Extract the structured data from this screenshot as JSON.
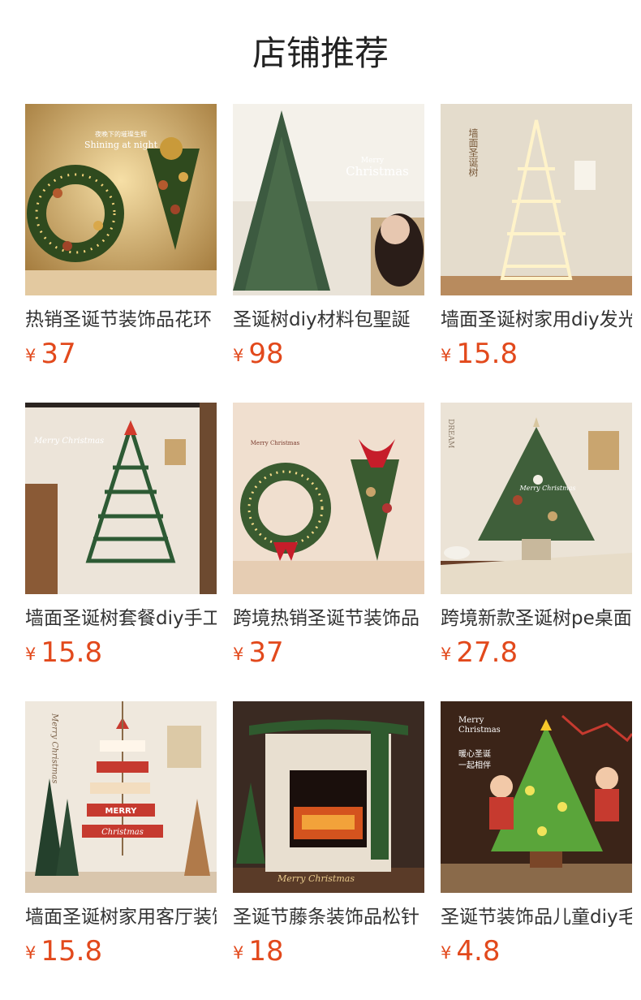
{
  "section": {
    "title": "店铺推荐"
  },
  "currency": "¥",
  "products": [
    {
      "name": "热销圣诞节装饰品花环",
      "price": "37",
      "image_text": [
        "夜晚下的璀璨生辉",
        "Shining at night"
      ],
      "icon": "christmas-wreath-icon"
    },
    {
      "name": "圣诞树diy材料包聖誕",
      "price": "98",
      "image_text": [
        "Merry",
        "Christmas"
      ],
      "icon": "christmas-tree-icon"
    },
    {
      "name": "墙面圣诞树家用diy发光",
      "price": "15.8",
      "image_text": [
        "墙面圣诞树"
      ],
      "icon": "wall-light-tree-icon"
    },
    {
      "name": "墙面圣诞树套餐diy手工",
      "price": "15.8",
      "image_text": [
        "Merry Christmas"
      ],
      "icon": "wall-garland-tree-icon"
    },
    {
      "name": "跨境热销圣诞节装饰品",
      "price": "37",
      "image_text": [
        "Merry Christmas"
      ],
      "icon": "wreath-pair-icon"
    },
    {
      "name": "跨境新款圣诞树pe桌面",
      "price": "27.8",
      "image_text": [
        "DREAM",
        "Merry Christmas"
      ],
      "icon": "tabletop-tree-icon"
    },
    {
      "name": "墙面圣诞树家用客厅装饰",
      "price": "15.8",
      "image_text": [
        "Merry Christmas",
        "MERRY",
        "Christmas"
      ],
      "icon": "wooden-sign-tree-icon"
    },
    {
      "name": "圣诞节藤条装饰品松针",
      "price": "18",
      "image_text": [
        "Merry Christmas"
      ],
      "icon": "fireplace-garland-icon"
    },
    {
      "name": "圣诞节装饰品儿童diy毛毡",
      "price": "4.8",
      "image_text": [
        "Merry",
        "Christmas",
        "暖心圣诞",
        "一起相伴"
      ],
      "icon": "felt-tree-icon"
    }
  ]
}
